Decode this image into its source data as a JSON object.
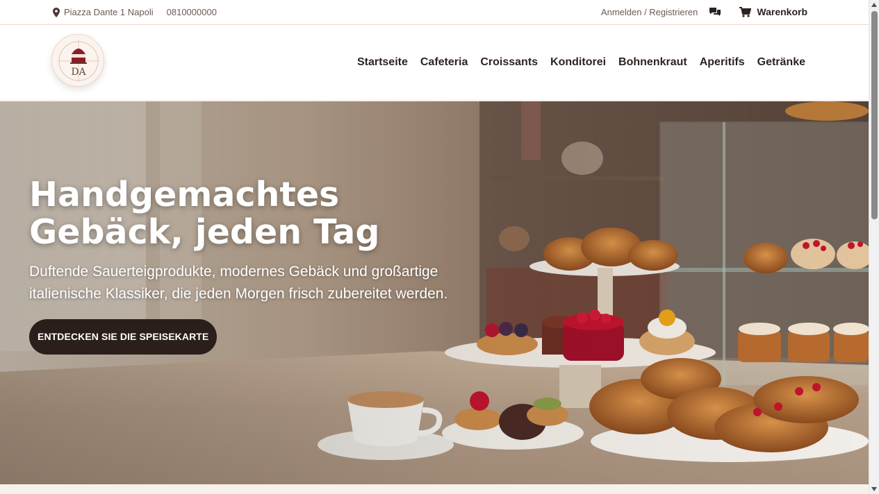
{
  "topbar": {
    "address": "Piazza Dante 1 Napoli",
    "phone": "0810000000",
    "login_label": "Anmelden / Registrieren",
    "cart_label": "Warenkorb",
    "icons": {
      "address": "map-pin-icon",
      "chat": "chat-bubbles-icon",
      "cart": "shopping-cart-icon"
    }
  },
  "header": {
    "logo_alt": "DA",
    "nav": [
      {
        "label": "Startseite"
      },
      {
        "label": "Cafeteria"
      },
      {
        "label": "Croissants"
      },
      {
        "label": "Konditorei"
      },
      {
        "label": "Bohnenkraut"
      },
      {
        "label": "Aperitifs"
      },
      {
        "label": "Getränke"
      }
    ]
  },
  "hero": {
    "title_line1": "Handgemachtes",
    "title_line2": "Gebäck, jeden Tag",
    "subtitle_line1": "Duftende Sauerteigprodukte, modernes Gebäck und großartige",
    "subtitle_line2": "italienische Klassiker, die jeden Morgen frisch zubereitet werden.",
    "cta_label": "ENTDECKEN SIE DIE SPEISEKARTE"
  },
  "colors": {
    "accent_dark": "#2a1f1b",
    "border_peach": "#f0d9cf",
    "text_dark": "#2e2320"
  }
}
